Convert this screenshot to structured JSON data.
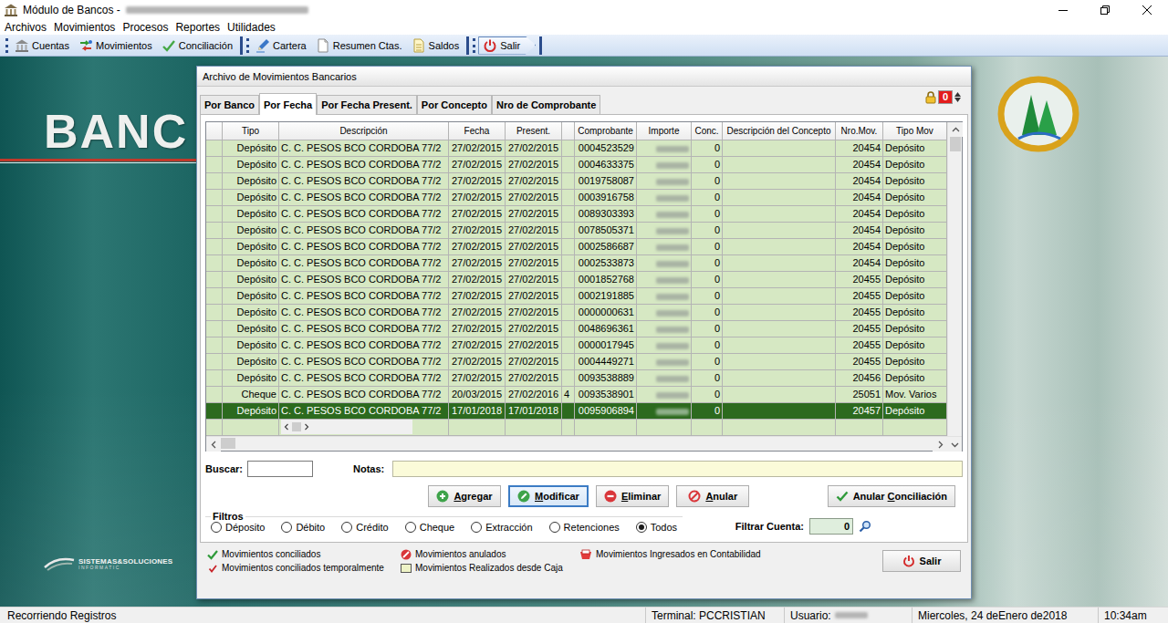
{
  "window": {
    "title": "Módulo de Bancos -",
    "title_redacted": true
  },
  "menu": [
    "Archivos",
    "Movimientos",
    "Procesos",
    "Reportes",
    "Utilidades"
  ],
  "toolbar": [
    [
      {
        "label": "Cuentas"
      },
      {
        "label": "Movimientos"
      },
      {
        "label": "Conciliación"
      }
    ],
    [
      {
        "label": "Cartera"
      },
      {
        "label": "Resumen Ctas."
      },
      {
        "label": "Saldos"
      }
    ],
    [
      {
        "label": "Salir"
      }
    ]
  ],
  "desktop": {
    "logo_text": "BANC",
    "vendor_name": "SISTEMAS&SOLUCIONES",
    "vendor_subtitle": "INFORMATIC"
  },
  "dialog": {
    "title": "Archivo de Movimientos Bancarios",
    "tabs": [
      {
        "label": "Por Banco",
        "selected": false
      },
      {
        "label": "Por Fecha",
        "selected": true
      },
      {
        "label": "Por Fecha Present.",
        "selected": false
      },
      {
        "label": "Por Concepto",
        "selected": false
      },
      {
        "label": "Nro de Comprobante",
        "selected": false
      }
    ],
    "lock_counter": "0",
    "table": {
      "columns": [
        "",
        "Tipo",
        "Descripción",
        "Fecha",
        "Present.",
        "",
        "Comprobante",
        "Importe",
        "Conc.",
        "Descripción del Concepto",
        "Nro.Mov.",
        "Tipo Mov"
      ],
      "rows": [
        {
          "tipo": "Depósito",
          "descripcion": "C. C. PESOS BCO CORDOBA 77/2",
          "fecha": "27/02/2015",
          "present": "27/02/2015",
          "marca": "",
          "comprobante": "0004523529",
          "importe_redacted": true,
          "conc": "0",
          "concepto": "",
          "nro_mov": "20454",
          "tipo_mov": "Depósito",
          "selected": false
        },
        {
          "tipo": "Depósito",
          "descripcion": "C. C. PESOS BCO CORDOBA 77/2",
          "fecha": "27/02/2015",
          "present": "27/02/2015",
          "marca": "",
          "comprobante": "0004633375",
          "importe_redacted": true,
          "conc": "0",
          "concepto": "",
          "nro_mov": "20454",
          "tipo_mov": "Depósito",
          "selected": false
        },
        {
          "tipo": "Depósito",
          "descripcion": "C. C. PESOS BCO CORDOBA 77/2",
          "fecha": "27/02/2015",
          "present": "27/02/2015",
          "marca": "",
          "comprobante": "0019758087",
          "importe_redacted": true,
          "conc": "0",
          "concepto": "",
          "nro_mov": "20454",
          "tipo_mov": "Depósito",
          "selected": false
        },
        {
          "tipo": "Depósito",
          "descripcion": "C. C. PESOS BCO CORDOBA 77/2",
          "fecha": "27/02/2015",
          "present": "27/02/2015",
          "marca": "",
          "comprobante": "0003916758",
          "importe_redacted": true,
          "conc": "0",
          "concepto": "",
          "nro_mov": "20454",
          "tipo_mov": "Depósito",
          "selected": false
        },
        {
          "tipo": "Depósito",
          "descripcion": "C. C. PESOS BCO CORDOBA 77/2",
          "fecha": "27/02/2015",
          "present": "27/02/2015",
          "marca": "",
          "comprobante": "0089303393",
          "importe_redacted": true,
          "conc": "0",
          "concepto": "",
          "nro_mov": "20454",
          "tipo_mov": "Depósito",
          "selected": false
        },
        {
          "tipo": "Depósito",
          "descripcion": "C. C. PESOS BCO CORDOBA 77/2",
          "fecha": "27/02/2015",
          "present": "27/02/2015",
          "marca": "",
          "comprobante": "0078505371",
          "importe_redacted": true,
          "conc": "0",
          "concepto": "",
          "nro_mov": "20454",
          "tipo_mov": "Depósito",
          "selected": false
        },
        {
          "tipo": "Depósito",
          "descripcion": "C. C. PESOS BCO CORDOBA 77/2",
          "fecha": "27/02/2015",
          "present": "27/02/2015",
          "marca": "",
          "comprobante": "0002586687",
          "importe_redacted": true,
          "conc": "0",
          "concepto": "",
          "nro_mov": "20454",
          "tipo_mov": "Depósito",
          "selected": false
        },
        {
          "tipo": "Depósito",
          "descripcion": "C. C. PESOS BCO CORDOBA 77/2",
          "fecha": "27/02/2015",
          "present": "27/02/2015",
          "marca": "",
          "comprobante": "0002533873",
          "importe_redacted": true,
          "conc": "0",
          "concepto": "",
          "nro_mov": "20454",
          "tipo_mov": "Depósito",
          "selected": false
        },
        {
          "tipo": "Depósito",
          "descripcion": "C. C. PESOS BCO CORDOBA 77/2",
          "fecha": "27/02/2015",
          "present": "27/02/2015",
          "marca": "",
          "comprobante": "0001852768",
          "importe_redacted": true,
          "conc": "0",
          "concepto": "",
          "nro_mov": "20455",
          "tipo_mov": "Depósito",
          "selected": false
        },
        {
          "tipo": "Depósito",
          "descripcion": "C. C. PESOS BCO CORDOBA 77/2",
          "fecha": "27/02/2015",
          "present": "27/02/2015",
          "marca": "",
          "comprobante": "0002191885",
          "importe_redacted": true,
          "conc": "0",
          "concepto": "",
          "nro_mov": "20455",
          "tipo_mov": "Depósito",
          "selected": false
        },
        {
          "tipo": "Depósito",
          "descripcion": "C. C. PESOS BCO CORDOBA 77/2",
          "fecha": "27/02/2015",
          "present": "27/02/2015",
          "marca": "",
          "comprobante": "0000000631",
          "importe_redacted": true,
          "conc": "0",
          "concepto": "",
          "nro_mov": "20455",
          "tipo_mov": "Depósito",
          "selected": false
        },
        {
          "tipo": "Depósito",
          "descripcion": "C. C. PESOS BCO CORDOBA 77/2",
          "fecha": "27/02/2015",
          "present": "27/02/2015",
          "marca": "",
          "comprobante": "0048696361",
          "importe_redacted": true,
          "conc": "0",
          "concepto": "",
          "nro_mov": "20455",
          "tipo_mov": "Depósito",
          "selected": false
        },
        {
          "tipo": "Depósito",
          "descripcion": "C. C. PESOS BCO CORDOBA 77/2",
          "fecha": "27/02/2015",
          "present": "27/02/2015",
          "marca": "",
          "comprobante": "0000017945",
          "importe_redacted": true,
          "conc": "0",
          "concepto": "",
          "nro_mov": "20455",
          "tipo_mov": "Depósito",
          "selected": false
        },
        {
          "tipo": "Depósito",
          "descripcion": "C. C. PESOS BCO CORDOBA 77/2",
          "fecha": "27/02/2015",
          "present": "27/02/2015",
          "marca": "",
          "comprobante": "0004449271",
          "importe_redacted": true,
          "conc": "0",
          "concepto": "",
          "nro_mov": "20455",
          "tipo_mov": "Depósito",
          "selected": false
        },
        {
          "tipo": "Depósito",
          "descripcion": "C. C. PESOS BCO CORDOBA 77/2",
          "fecha": "27/02/2015",
          "present": "27/02/2015",
          "marca": "",
          "comprobante": "0093538889",
          "importe_redacted": true,
          "conc": "0",
          "concepto": "",
          "nro_mov": "20456",
          "tipo_mov": "Depósito",
          "selected": false
        },
        {
          "tipo": "Cheque",
          "descripcion": "C. C. PESOS BCO CORDOBA 77/2",
          "fecha": "20/03/2015",
          "present": "27/02/2016",
          "marca": "4",
          "comprobante": "0093538901",
          "importe_redacted": true,
          "conc": "0",
          "concepto": "",
          "nro_mov": "25051",
          "tipo_mov": "Mov. Varios",
          "selected": false
        },
        {
          "tipo": "Depósito",
          "descripcion": "C. C. PESOS BCO CORDOBA 77/2",
          "fecha": "17/01/2018",
          "present": "17/01/2018",
          "marca": "",
          "comprobante": "0095906894",
          "importe_redacted": true,
          "conc": "0",
          "concepto": "",
          "nro_mov": "20457",
          "tipo_mov": "Depósito",
          "selected": true
        }
      ]
    },
    "search": {
      "label": "Buscar:",
      "value": ""
    },
    "notes": {
      "label": "Notas:",
      "value": ""
    },
    "buttons": [
      {
        "label": "Agregar",
        "accel": 0,
        "focused": false
      },
      {
        "label": "Modificar",
        "accel": 0,
        "focused": true
      },
      {
        "label": "Eliminar",
        "accel": 0,
        "focused": false
      },
      {
        "label": "Anular",
        "accel": 0,
        "focused": false
      }
    ],
    "clear_reconciliation_button": {
      "label": "Anular Conciliación",
      "accel": 7,
      "focused": false
    },
    "filters": {
      "title": "Filtros",
      "options": [
        {
          "label": "Déposito",
          "selected": false
        },
        {
          "label": "Débito",
          "selected": false
        },
        {
          "label": "Crédito",
          "selected": false
        },
        {
          "label": "Cheque",
          "selected": false
        },
        {
          "label": "Extracción",
          "selected": false
        },
        {
          "label": "Retenciones",
          "selected": false
        },
        {
          "label": "Todos",
          "selected": true
        }
      ]
    },
    "account_filter": {
      "label": "Filtrar Cuenta:",
      "value": "0"
    },
    "legend": [
      {
        "label": "Movimientos conciliados",
        "kind": "check"
      },
      {
        "label": "Movimientos anulados",
        "kind": "void"
      },
      {
        "label": "Movimientos Ingresados en Contabilidad",
        "kind": "ledger"
      },
      {
        "label": "Movimientos conciliados temporalmente",
        "kind": "check-temp"
      },
      {
        "label": "Movimientos Realizados desde Caja",
        "kind": "cash"
      }
    ],
    "exit_button": {
      "label": "Salir"
    }
  },
  "status_bar": {
    "message": "Recorriendo Registros",
    "terminal": "Terminal: PCCRISTIAN",
    "user": "Usuario:",
    "user_redacted": true,
    "date": "Miercoles, 24 deEnero de2018",
    "time": "10:34am"
  }
}
